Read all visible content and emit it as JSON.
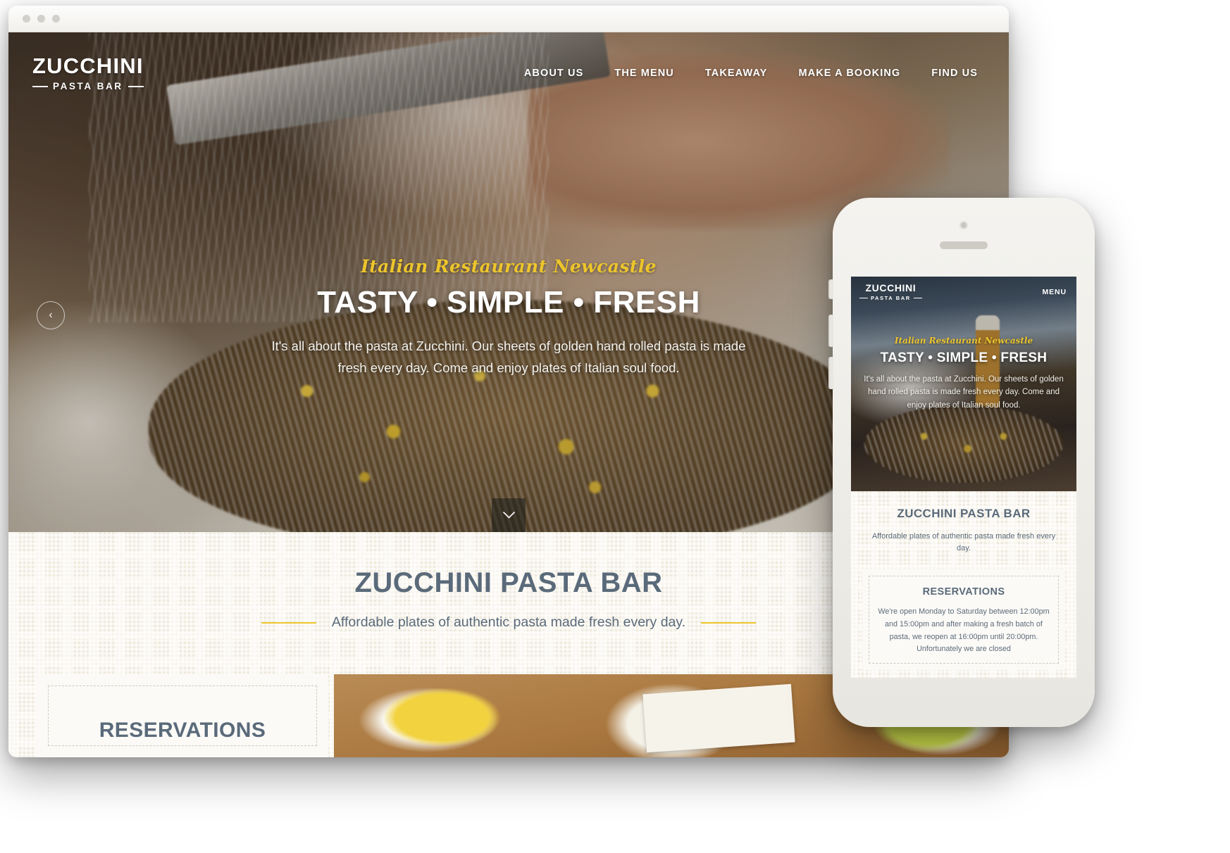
{
  "browser": {
    "window_dots": [
      "dot-1",
      "dot-2",
      "dot-3"
    ]
  },
  "site": {
    "logo": {
      "main": "ZUCCHINI",
      "sub": "PASTA BAR"
    },
    "nav": [
      {
        "label": "ABOUT US"
      },
      {
        "label": "THE MENU"
      },
      {
        "label": "TAKEAWAY"
      },
      {
        "label": "MAKE A BOOKING"
      },
      {
        "label": "FIND US"
      }
    ],
    "hero": {
      "script": "Italian Restaurant Newcastle",
      "headline": "TASTY • SIMPLE • FRESH",
      "paragraph": "It's all about the pasta at Zucchini. Our sheets of golden hand rolled pasta is made fresh every day.  Come and enjoy plates of Italian soul food.",
      "prev_arrow": "‹",
      "scroll_chevron": "⌄"
    },
    "section": {
      "title": "ZUCCHINI PASTA BAR",
      "tagline": "Affordable plates of authentic pasta made fresh every day."
    },
    "reservations": {
      "title": "RESERVATIONS"
    }
  },
  "phone": {
    "logo": {
      "main": "ZUCCHINI",
      "sub": "PASTA BAR"
    },
    "menu_label": "MENU",
    "hero": {
      "script": "Italian Restaurant Newcastle",
      "headline": "TASTY • SIMPLE • FRESH",
      "paragraph": "It's all about the pasta at Zucchini. Our sheets of golden hand rolled pasta is made fresh every day.  Come and enjoy plates of Italian soul food."
    },
    "section": {
      "title": "ZUCCHINI PASTA BAR",
      "tagline": "Affordable plates of authentic pasta made fresh every day."
    },
    "reservations": {
      "title": "RESERVATIONS",
      "body": "We're open Monday to Saturday between 12:00pm and 15:00pm and after making a fresh batch of pasta, we reopen at 16:00pm until 20:00pm. Unfortunately we are closed"
    }
  },
  "colors": {
    "accent_yellow": "#edc52c",
    "heading_slate": "#5a6a7a",
    "pattern_cream": "#efeadd",
    "card_white": "#fbfaf7"
  }
}
